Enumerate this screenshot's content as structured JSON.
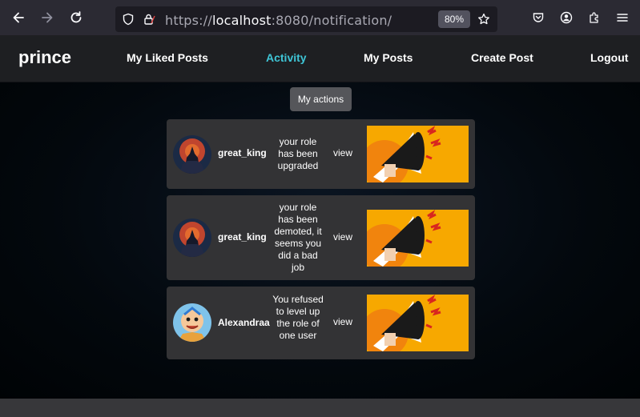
{
  "browser": {
    "url_scheme": "https://",
    "url_host": "localhost",
    "url_rest": ":8080/notification/",
    "zoom": "80%"
  },
  "nav": {
    "brand": "prince",
    "links": {
      "liked": "My Liked Posts",
      "activity": "Activity",
      "posts": "My Posts",
      "create": "Create Post",
      "logout": "Logout"
    },
    "accent_color": "#3fc5d6"
  },
  "tooltip": "My actions",
  "notifications": [
    {
      "user": "great_king",
      "message": "your role has been upgraded",
      "action": "view",
      "avatar": "dark-figure"
    },
    {
      "user": "great_king",
      "message": "your role has been demoted, it seems you did a bad job",
      "action": "view",
      "avatar": "dark-figure"
    },
    {
      "user": "Alexandraa",
      "message": "You refused to level up the role of one user",
      "action": "view",
      "avatar": "cartoon-boy"
    }
  ]
}
